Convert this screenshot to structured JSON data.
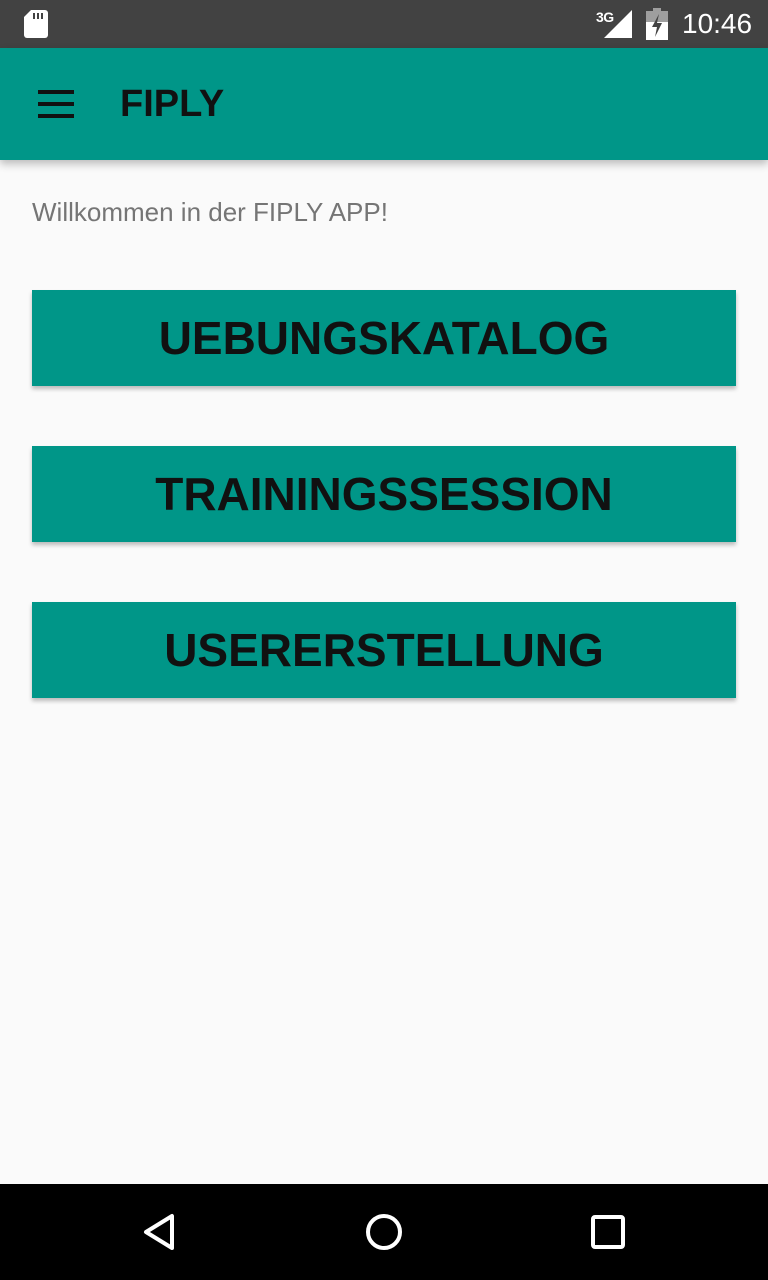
{
  "status_bar": {
    "network_type": "3G",
    "time": "10:46",
    "icons": [
      "sd-card-icon",
      "cell-signal-icon",
      "battery-charging-icon"
    ]
  },
  "app_bar": {
    "title": "FIPLY",
    "menu_icon": "hamburger-menu-icon",
    "background_color": "#009688"
  },
  "main": {
    "welcome_text": "Willkommen in der FIPLY APP!",
    "buttons": [
      {
        "label": "UEBUNGSKATALOG"
      },
      {
        "label": "TRAININGSSESSION"
      },
      {
        "label": "USERERSTELLUNG"
      }
    ],
    "button_color": "#009688"
  },
  "nav_bar": {
    "icons": [
      "back-icon",
      "home-icon",
      "recents-icon"
    ]
  }
}
